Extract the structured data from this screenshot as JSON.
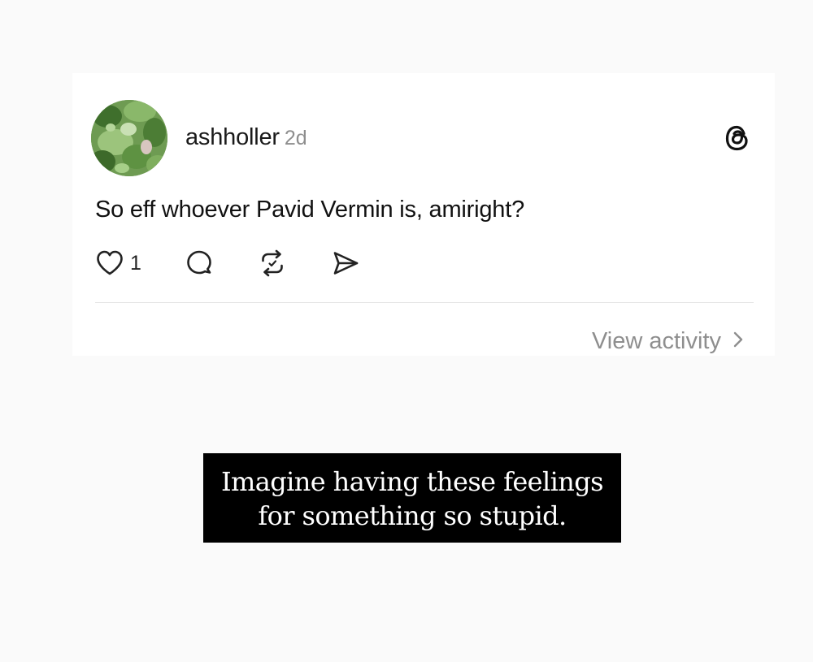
{
  "post": {
    "username": "ashholler",
    "time": "2d",
    "text": "So eff whoever Pavid Vermin is, amiright?",
    "like_count": "1",
    "view_activity": "View activity",
    "icons": {
      "avatar": "leafy-plant-avatar",
      "logo": "threads-logo-icon",
      "like": "heart-icon",
      "reply": "comment-bubble-icon",
      "repost": "repost-arrows-icon",
      "share": "send-icon",
      "chevron": "chevron-right-icon"
    }
  },
  "caption": {
    "line1": "Imagine having these feelings",
    "line2": "for something so stupid."
  },
  "colors": {
    "page_background": "#fafafa",
    "card_background": "#ffffff",
    "secondary_text": "#8e8e8e",
    "caption_background": "#000000",
    "caption_text": "#ffffff"
  }
}
